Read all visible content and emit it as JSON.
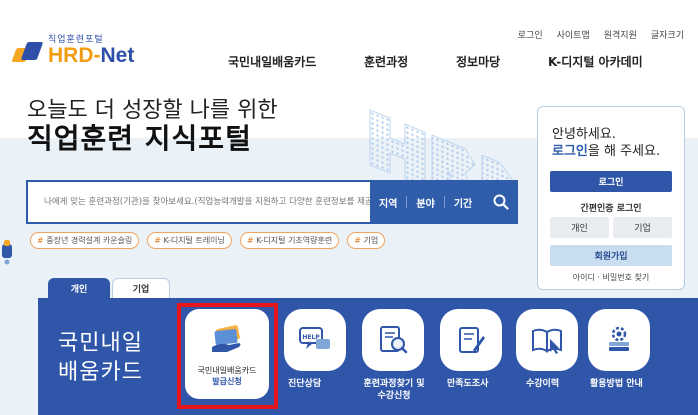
{
  "logo": {
    "sub": "직업훈련포털",
    "main_hrd": "HRD",
    "main_dash": "-",
    "main_net": "Net"
  },
  "util_nav": [
    "로그인",
    "사이트맵",
    "원격지원",
    "글자크기"
  ],
  "gnb": [
    "국민내일배움카드",
    "훈련과정",
    "정보마당",
    "K-디지털 아카데미"
  ],
  "hero": {
    "line1": "오늘도 더 성장할 나를 위한",
    "line2": "직업훈련 지식포털"
  },
  "search": {
    "placeholder": "나에게 맞는 훈련과정(기관)을 찾아보세요.(직업능력개발을 지원하고 다양한 훈련정보를 제공합니다.)",
    "tabs": [
      "지역",
      "분야",
      "기간"
    ]
  },
  "hashtags": [
    "중장년 경력설계 카운슬링",
    "K-디지털 트레이닝",
    "K-디지털 기초역량훈련",
    "기업"
  ],
  "hashtag_symbol": "#",
  "login": {
    "greeting": "안녕하세요.",
    "ask_link": "로그인",
    "ask_rest": "을 해 주세요.",
    "login_button": "로그인",
    "simple_label": "간편인증 로그인",
    "individual": "개인",
    "business": "기업",
    "join": "회원가입",
    "find": "아이디 · 비밀번호 찾기"
  },
  "tabs": {
    "individual": "개인",
    "business": "기업"
  },
  "card": {
    "title_line1": "국민내일",
    "title_line2": "배움카드",
    "featured_line1": "국민내일배움카드",
    "featured_line2": "발급신청",
    "items": [
      {
        "label1": "진단상담",
        "label2": "",
        "icon": "help-chat-icon"
      },
      {
        "label1": "훈련과정찾기 및",
        "label2": "수강신청",
        "icon": "search-document-icon"
      },
      {
        "label1": "만족도조사",
        "label2": "",
        "icon": "survey-pen-icon"
      },
      {
        "label1": "수강이력",
        "label2": "",
        "icon": "book-cursor-icon"
      },
      {
        "label1": "활용방법 안내",
        "label2": "",
        "icon": "gear-stack-icon"
      }
    ]
  },
  "colors": {
    "primary": "#2f56a8",
    "accent": "#f39c12",
    "highlight": "#e8141b",
    "band": "#eaf1f7"
  }
}
